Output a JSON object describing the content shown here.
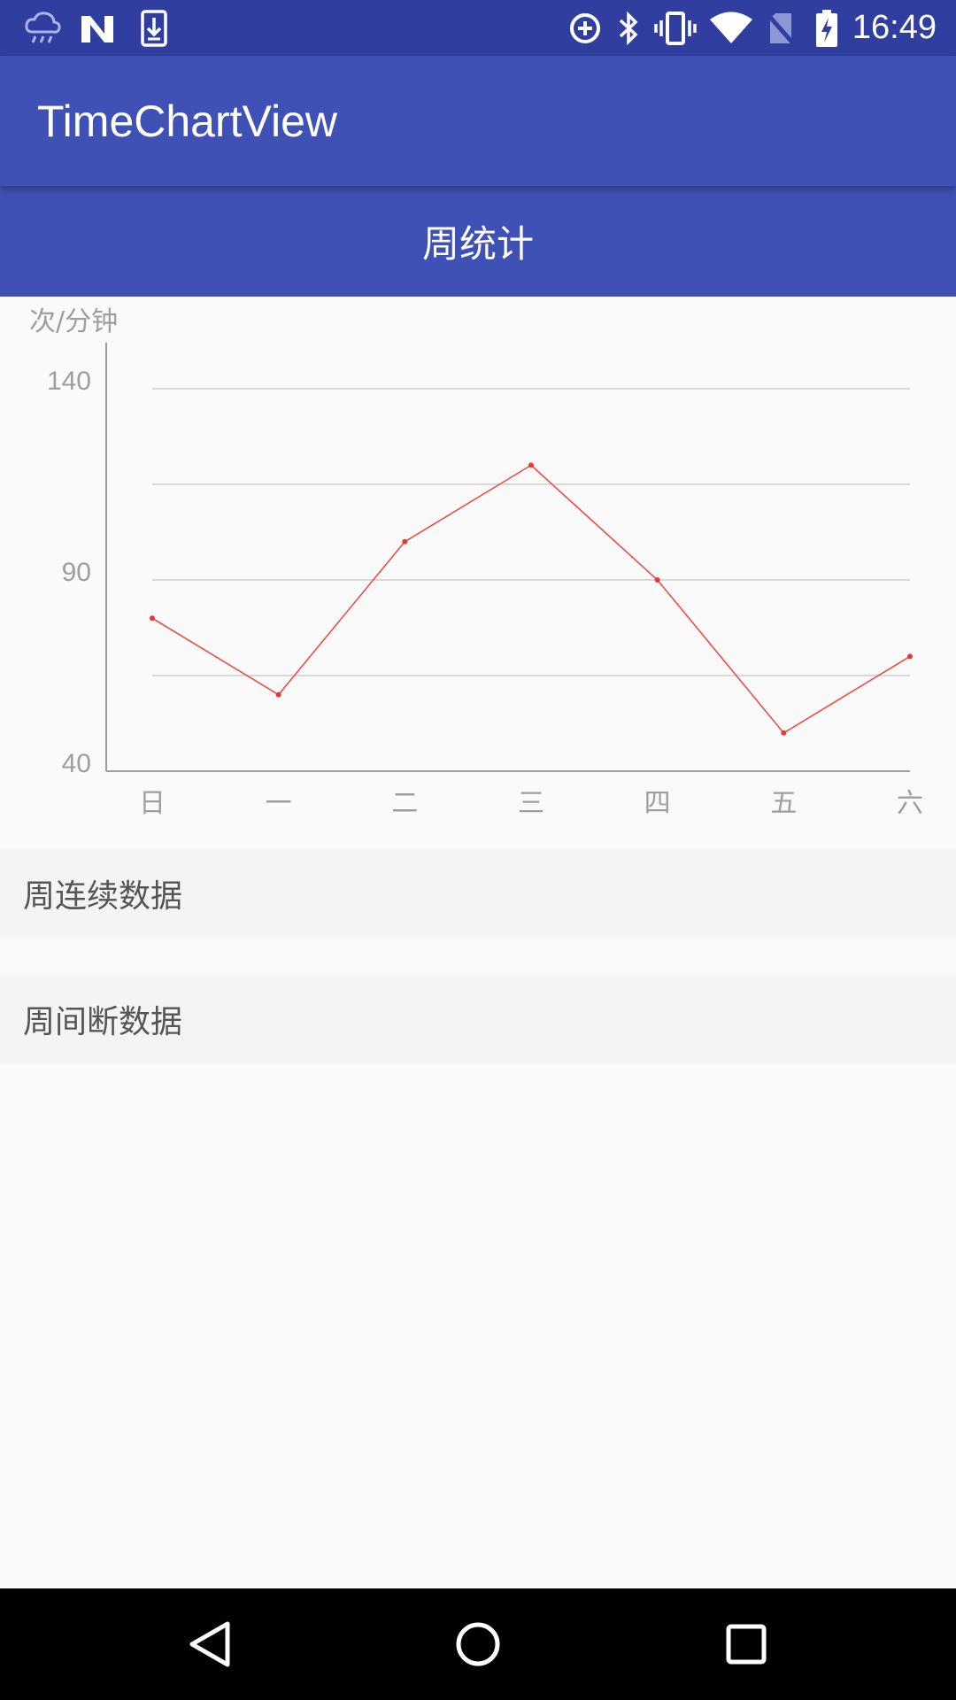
{
  "status_bar": {
    "time": "16:49",
    "left_icons": [
      "cloud-rain-icon",
      "n-logo-icon",
      "download-icon"
    ],
    "right_icons": [
      "data-saver-icon",
      "bluetooth-icon",
      "vibrate-icon",
      "wifi-icon",
      "no-sim-icon",
      "battery-charging-icon"
    ]
  },
  "app_bar": {
    "title": "TimeChartView"
  },
  "week_header": {
    "title": "周统计"
  },
  "chart_data": {
    "type": "line",
    "ylabel": "次/分钟",
    "categories": [
      "日",
      "一",
      "二",
      "三",
      "四",
      "五",
      "六"
    ],
    "series": [
      {
        "values": [
          80,
          60,
          100,
          120,
          90,
          50,
          70
        ]
      }
    ],
    "ylim": [
      40,
      140
    ],
    "yticks": [
      "140",
      "90",
      "40"
    ],
    "grid": true,
    "line_color": "#f44336"
  },
  "list": {
    "continuous": "周连续数据",
    "intermittent": "周间断数据"
  },
  "nav_bar": {
    "icons": [
      "back-icon",
      "home-icon",
      "recents-icon"
    ]
  },
  "colors": {
    "status_bar": "#303f9f",
    "primary": "#3f51b5",
    "background": "#fafafa",
    "row_background": "#f3f4f6"
  }
}
